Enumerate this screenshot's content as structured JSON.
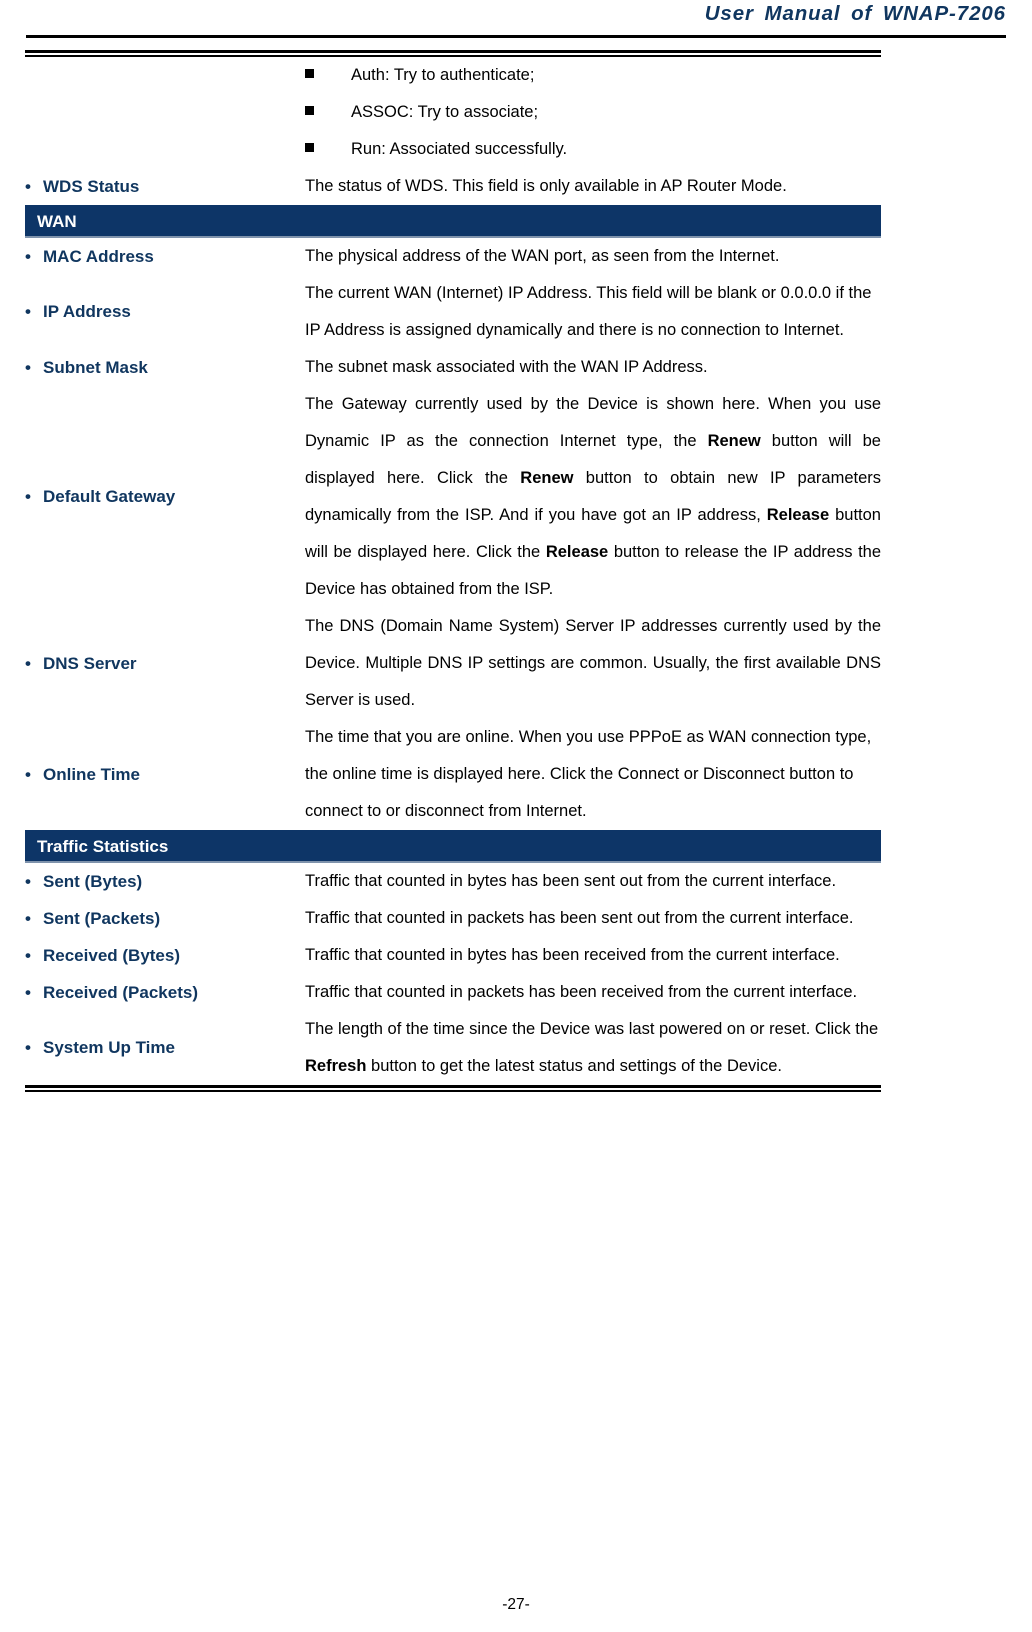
{
  "header": {
    "title": "User Manual of WNAP-7206"
  },
  "footer": {
    "page_number": "-27-"
  },
  "colors": {
    "band_background": "#0d3567",
    "label_text": "#10365f",
    "header_text": "#10365f",
    "rule": "#9a9a9a"
  },
  "table": {
    "rows": [
      {
        "type": "bullet-list",
        "label": "",
        "items": [
          "Auth: Try to authenticate;",
          "ASSOC: Try to associate;",
          "Run: Associated successfully."
        ]
      },
      {
        "type": "entry",
        "label": "WDS Status",
        "desc": "The status of WDS. This field is only available in AP Router Mode.",
        "align": "left"
      },
      {
        "type": "band",
        "label": "WAN"
      },
      {
        "type": "entry",
        "label": "MAC Address",
        "desc": "The physical address of the WAN port, as seen from the Internet.",
        "align": "justify"
      },
      {
        "type": "entry",
        "label": "IP Address",
        "desc": "The current WAN (Internet) IP Address. This field will be blank or 0.0.0.0 if the IP Address is assigned dynamically and there is no connection to Internet.",
        "align": "left"
      },
      {
        "type": "entry",
        "label": "Subnet Mask",
        "desc": "The subnet mask associated with the WAN IP Address.",
        "align": "left"
      },
      {
        "type": "entry-rich",
        "label": "Default Gateway",
        "desc_html": "The Gateway currently used by the Device is shown here. When you use Dynamic IP as the connection Internet type, the <b>Renew</b> button will be displayed here. Click the <b>Renew</b> button to obtain new IP parameters dynamically from the ISP. And if you have got an IP address, <b>Release</b> button will be displayed here. Click the <b>Release</b> button to release the IP address the Device has obtained from the ISP.",
        "align": "justify"
      },
      {
        "type": "entry",
        "label": "DNS Server",
        "desc": "The DNS (Domain Name System) Server IP addresses currently used by the Device. Multiple DNS IP settings are common. Usually, the first available DNS Server is used.",
        "align": "justify"
      },
      {
        "type": "entry",
        "label": "Online Time",
        "desc": "The time that you are online. When you use PPPoE as WAN connection type, the online time is displayed here. Click the Connect or Disconnect button to connect to or disconnect from Internet.",
        "align": "left"
      },
      {
        "type": "band",
        "label": "Traffic Statistics"
      },
      {
        "type": "entry",
        "label": "Sent (Bytes)",
        "desc": "Traffic that counted in bytes has been sent out from the current interface.",
        "align": "left"
      },
      {
        "type": "entry",
        "label": "Sent (Packets)",
        "desc": "Traffic that counted in packets has been sent out from the current interface.",
        "align": "justify"
      },
      {
        "type": "entry",
        "label": "Received (Bytes)",
        "desc": "Traffic that counted in bytes has been received from the current interface.",
        "align": "justify"
      },
      {
        "type": "entry",
        "label": "Received (Packets)",
        "desc": "Traffic that counted in packets has been received from the current interface.",
        "align": "justify"
      },
      {
        "type": "entry-rich",
        "label": "System Up Time",
        "desc_html": "The length of the time since the Device was last powered on or reset. Click the <b>Refresh</b> button to get the latest status and settings of the Device.",
        "align": "left"
      }
    ]
  }
}
